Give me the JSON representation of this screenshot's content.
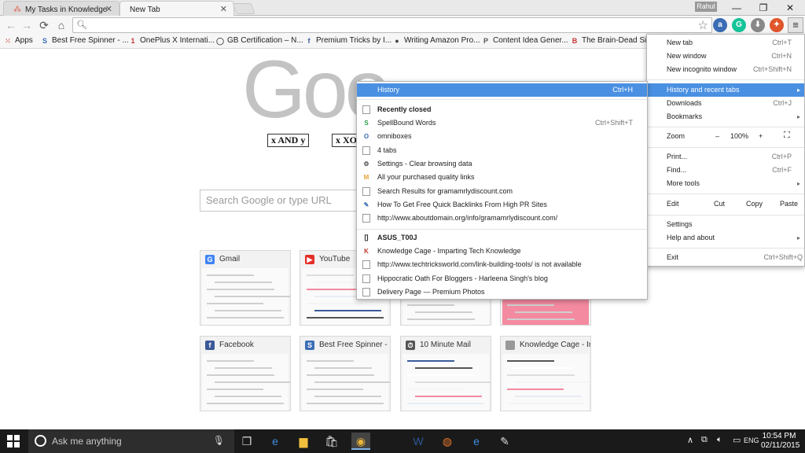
{
  "tabs": [
    {
      "title": "My Tasks in Knowledge",
      "active": false
    },
    {
      "title": "New Tab",
      "active": true
    }
  ],
  "user_badge": "Rahul",
  "window_controls": {
    "minimize": "—",
    "maximize": "❐",
    "close": "✕"
  },
  "toolbar": {
    "back": "←",
    "forward": "→",
    "reload": "⟳",
    "home": "⌂",
    "omnibox_value": "",
    "extensions": [
      {
        "name": "lastpass",
        "glyph": "a",
        "color": "#3b6db5"
      },
      {
        "name": "grammarly",
        "glyph": "G",
        "color": "#15c39a"
      },
      {
        "name": "download",
        "glyph": "⬇",
        "color": "#888"
      },
      {
        "name": "hotspot",
        "glyph": "✦",
        "color": "#e0562b"
      }
    ]
  },
  "bookmarks": [
    {
      "label": "Apps",
      "icon": "apps-grid",
      "color": "#d44"
    },
    {
      "label": "Best Free Spinner - ...",
      "icon": "S",
      "color": "#3b6db5"
    },
    {
      "label": "OnePlus X Internati...",
      "icon": "1",
      "color": "#c33"
    },
    {
      "label": "GB Certification – N...",
      "icon": "◯",
      "color": "#555"
    },
    {
      "label": "Premium Tricks by I...",
      "icon": "f",
      "color": "#3b5998"
    },
    {
      "label": "Writing Amazon Pro...",
      "icon": "●",
      "color": "#444"
    },
    {
      "label": "Content Idea Gener...",
      "icon": "P",
      "color": "#555"
    },
    {
      "label": "The Brain-Dead Sim...",
      "icon": "B",
      "color": "#c33"
    }
  ],
  "page": {
    "logo_text": "Goo",
    "doodle_left": "x AND y",
    "doodle_right": "x XO",
    "search_placeholder": "Search Google or type URL",
    "tiles": [
      {
        "title": "Gmail",
        "icon": "G",
        "color": "#4285f4"
      },
      {
        "title": "YouTube",
        "icon": "▶",
        "color": "#e52d27"
      },
      {
        "title": "",
        "icon": "",
        "color": "#fff"
      },
      {
        "title": "",
        "icon": "",
        "color": "#fff"
      },
      {
        "title": "Facebook",
        "icon": "f",
        "color": "#3b5998"
      },
      {
        "title": "Best Free Spinner - F",
        "icon": "S",
        "color": "#3b6db5"
      },
      {
        "title": "10 Minute Mail",
        "icon": "⏱",
        "color": "#555"
      },
      {
        "title": "Knowledge Cage - Im",
        "icon": "",
        "color": "#999"
      }
    ]
  },
  "main_menu": {
    "new_tab": {
      "label": "New tab",
      "shortcut": "Ctrl+T"
    },
    "new_window": {
      "label": "New window",
      "shortcut": "Ctrl+N"
    },
    "incognito": {
      "label": "New incognito window",
      "shortcut": "Ctrl+Shift+N"
    },
    "history": {
      "label": "History and recent tabs"
    },
    "downloads": {
      "label": "Downloads",
      "shortcut": "Ctrl+J"
    },
    "bookmarks": {
      "label": "Bookmarks"
    },
    "zoom": {
      "label": "Zoom",
      "minus": "–",
      "value": "100%",
      "plus": "+",
      "fullscreen": "⛶"
    },
    "print": {
      "label": "Print...",
      "shortcut": "Ctrl+P"
    },
    "find": {
      "label": "Find...",
      "shortcut": "Ctrl+F"
    },
    "more_tools": {
      "label": "More tools"
    },
    "edit": {
      "label": "Edit",
      "cut": "Cut",
      "copy": "Copy",
      "paste": "Paste"
    },
    "settings": {
      "label": "Settings"
    },
    "help": {
      "label": "Help and about"
    },
    "exit": {
      "label": "Exit",
      "shortcut": "Ctrl+Shift+Q"
    }
  },
  "history_menu": {
    "history": {
      "label": "History",
      "shortcut": "Ctrl+H"
    },
    "recently_closed": "Recently closed",
    "recent": [
      {
        "label": "SpellBound Words",
        "shortcut": "Ctrl+Shift+T",
        "icon": "S",
        "color": "#2a9d4a"
      },
      {
        "label": "omniboxes",
        "icon": "O",
        "color": "#3b6db5"
      },
      {
        "label": "4 tabs",
        "icon": "",
        "color": ""
      },
      {
        "label": "Settings - Clear browsing data",
        "icon": "⚙",
        "color": "#555"
      },
      {
        "label": "All your purchased quality links",
        "icon": "M",
        "color": "#e8a33c"
      },
      {
        "label": "Search Results for gramamrlydiscount.com",
        "icon": "",
        "color": ""
      },
      {
        "label": "How To Get Free Quick Backlinks From High PR Sites",
        "icon": "✎",
        "color": "#3b6db5"
      },
      {
        "label": "http://www.aboutdomain.org/info/gramamrlydiscount.com/",
        "icon": "",
        "color": ""
      }
    ],
    "device": "ASUS_T00J",
    "device_tabs": [
      {
        "label": "Knowledge Cage - Imparting Tech Knowledge",
        "icon": "K",
        "color": "#c0392b"
      },
      {
        "label": "http://www.techtricksworld.com/link-building-tools/ is not available",
        "icon": "",
        "color": ""
      },
      {
        "label": "Hippocratic Oath For Bloggers - Harleena Singh's blog",
        "icon": "",
        "color": ""
      },
      {
        "label": "Delivery Page — Premium Photos",
        "icon": "",
        "color": ""
      }
    ]
  },
  "taskbar": {
    "search_placeholder": "Ask me anything",
    "apps": [
      {
        "name": "task-view",
        "glyph": "❐"
      },
      {
        "name": "edge",
        "glyph": "e"
      },
      {
        "name": "file-explorer",
        "glyph": "▆"
      },
      {
        "name": "store",
        "glyph": "🛍"
      },
      {
        "name": "chrome",
        "glyph": "◉"
      },
      {
        "name": "word",
        "glyph": "W"
      },
      {
        "name": "firefox",
        "glyph": "◍"
      },
      {
        "name": "ie",
        "glyph": "e"
      },
      {
        "name": "paint",
        "glyph": "✎"
      }
    ],
    "time": "10:54 PM",
    "date": "02/11/2015",
    "lang": "ENG"
  }
}
